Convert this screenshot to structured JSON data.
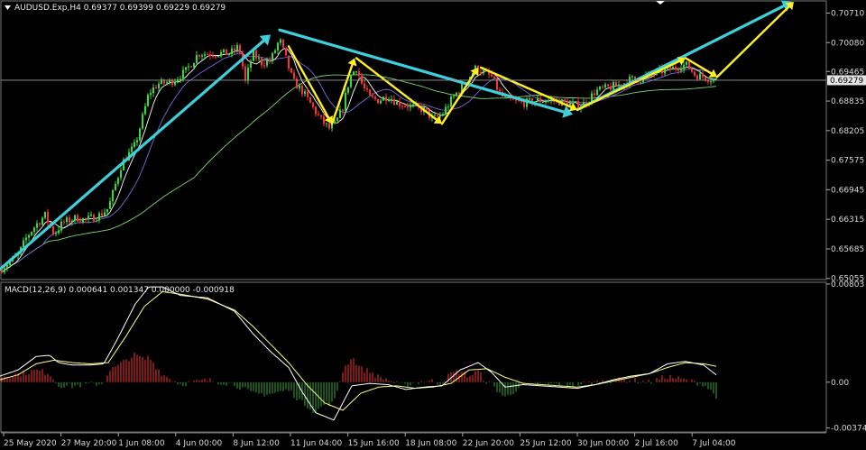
{
  "window": {
    "symbol_header": "AUDUSD.Exp,H4  0.69377 0.69399 0.69229 0.69279",
    "macd_header": "MACD(12,26,9) 0.000641 0.001347 0.000000 -0.000918"
  },
  "colors": {
    "background": "#000000",
    "bull_candle": "#33dd33",
    "bear_candle": "#ff3030",
    "ma_fast": "#ffffff",
    "ma_slow": "#7b68d8",
    "ma_long": "#7fd46f",
    "cyan_arrow": "#3ecfdc",
    "yellow_arrow": "#ffee22",
    "hist_pos": "#d12a2a",
    "hist_neg": "#2e8a2e",
    "macd_line": "#ffffff",
    "signal_line": "#ffff80"
  },
  "chart_data": [
    {
      "type": "candlestick",
      "symbol": "AUDUSD.Exp",
      "timeframe": "H4",
      "last_price": "0.69279",
      "ylim": [
        0.6505,
        0.7095
      ],
      "y_ticks": [
        "0.70710",
        "0.70080",
        "0.69465",
        "0.68835",
        "0.68205",
        "0.67575",
        "0.66945",
        "0.66315",
        "0.65685",
        "0.65055"
      ],
      "y_tick_values": [
        0.7071,
        0.7008,
        0.69465,
        0.68835,
        0.68205,
        0.67575,
        0.66945,
        0.66315,
        0.65685,
        0.65055
      ],
      "x_ticks": [
        "25 May 2020",
        "27 May 20:00",
        "1 Jun 08:00",
        "4 Jun 00:00",
        "8 Jun 12:00",
        "11 Jun 04:00",
        "15 Jun 16:00",
        "18 Jun 08:00",
        "22 Jun 20:00",
        "25 Jun 12:00",
        "30 Jun 00:00",
        "2 Jul 16:00",
        "7 Jul 04:00"
      ],
      "price_path": [
        [
          0,
          0.6525
        ],
        [
          10,
          0.654
        ],
        [
          20,
          0.6555
        ],
        [
          30,
          0.6595
        ],
        [
          40,
          0.662
        ],
        [
          50,
          0.664
        ],
        [
          60,
          0.66
        ],
        [
          70,
          0.6625
        ],
        [
          85,
          0.6635
        ],
        [
          95,
          0.663
        ],
        [
          110,
          0.664
        ],
        [
          120,
          0.6655
        ],
        [
          135,
          0.675
        ],
        [
          150,
          0.679
        ],
        [
          165,
          0.69
        ],
        [
          175,
          0.692
        ],
        [
          190,
          0.6925
        ],
        [
          205,
          0.6945
        ],
        [
          220,
          0.6985
        ],
        [
          240,
          0.6985
        ],
        [
          255,
          0.6985
        ],
        [
          265,
          0.7
        ],
        [
          272,
          0.6925
        ],
        [
          280,
          0.6985
        ],
        [
          290,
          0.6965
        ],
        [
          300,
          0.697
        ],
        [
          310,
          0.7015
        ],
        [
          315,
          0.6985
        ],
        [
          325,
          0.6925
        ],
        [
          335,
          0.6905
        ],
        [
          345,
          0.6875
        ],
        [
          355,
          0.6845
        ],
        [
          365,
          0.6825
        ],
        [
          372,
          0.6835
        ],
        [
          380,
          0.687
        ],
        [
          388,
          0.6935
        ],
        [
          395,
          0.6955
        ],
        [
          402,
          0.6915
        ],
        [
          410,
          0.689
        ],
        [
          420,
          0.6885
        ],
        [
          430,
          0.6895
        ],
        [
          440,
          0.688
        ],
        [
          450,
          0.6875
        ],
        [
          460,
          0.687
        ],
        [
          470,
          0.6865
        ],
        [
          480,
          0.6845
        ],
        [
          490,
          0.6855
        ],
        [
          500,
          0.6885
        ],
        [
          510,
          0.691
        ],
        [
          520,
          0.6935
        ],
        [
          528,
          0.6955
        ],
        [
          535,
          0.6945
        ],
        [
          545,
          0.6935
        ],
        [
          555,
          0.6895
        ],
        [
          565,
          0.6885
        ],
        [
          575,
          0.688
        ],
        [
          585,
          0.688
        ],
        [
          595,
          0.6885
        ],
        [
          605,
          0.6885
        ],
        [
          615,
          0.6885
        ],
        [
          625,
          0.688
        ],
        [
          635,
          0.6875
        ],
        [
          645,
          0.6875
        ],
        [
          652,
          0.6885
        ],
        [
          660,
          0.6905
        ],
        [
          670,
          0.691
        ],
        [
          680,
          0.6915
        ],
        [
          690,
          0.692
        ],
        [
          700,
          0.693
        ],
        [
          710,
          0.693
        ],
        [
          720,
          0.694
        ],
        [
          730,
          0.6945
        ],
        [
          740,
          0.695
        ],
        [
          750,
          0.6955
        ],
        [
          755,
          0.696
        ],
        [
          762,
          0.696
        ],
        [
          770,
          0.694
        ],
        [
          780,
          0.6935
        ],
        [
          790,
          0.693
        ],
        [
          794,
          0.6928
        ]
      ],
      "indicator_lines": [
        "fast MA",
        "slow MA",
        "long MA"
      ],
      "annotations": {
        "cyan_arrows": [
          [
            [
              0,
              0.6525
            ],
            [
              300,
              0.7025
            ]
          ],
          [
            [
              310,
              0.7035
            ],
            [
              635,
              0.6855
            ]
          ],
          [
            [
              640,
              0.6865
            ],
            [
              878,
              0.7095
            ]
          ]
        ],
        "yellow_arrows": [
          [
            [
              320,
              0.7
            ],
            [
              368,
              0.6835
            ]
          ],
          [
            [
              368,
              0.6835
            ],
            [
              393,
              0.6975
            ]
          ],
          [
            [
              395,
              0.6975
            ],
            [
              490,
              0.6835
            ]
          ],
          [
            [
              490,
              0.6835
            ],
            [
              530,
              0.6955
            ]
          ],
          [
            [
              533,
              0.6955
            ],
            [
              640,
              0.6865
            ]
          ],
          [
            [
              640,
              0.6865
            ],
            [
              760,
              0.6975
            ]
          ],
          [
            [
              760,
              0.6975
            ],
            [
              795,
              0.6935
            ]
          ],
          [
            [
              795,
              0.6935
            ],
            [
              880,
              0.7095
            ]
          ]
        ]
      }
    },
    {
      "type": "line+histogram",
      "indicator": "MACD(12,26,9)",
      "ylim": [
        -0.004,
        0.0081
      ],
      "y_ticks": [
        "0.00803",
        "0.00",
        "-0.003749"
      ],
      "y_tick_values": [
        0.00803,
        0,
        -0.003749
      ],
      "macd_path": [
        [
          0,
          0.0005
        ],
        [
          20,
          0.001
        ],
        [
          40,
          0.0021
        ],
        [
          55,
          0.0022
        ],
        [
          65,
          0.0016
        ],
        [
          80,
          0.0014
        ],
        [
          100,
          0.0014
        ],
        [
          115,
          0.0015
        ],
        [
          130,
          0.0035
        ],
        [
          150,
          0.0064
        ],
        [
          165,
          0.0078
        ],
        [
          180,
          0.0078
        ],
        [
          200,
          0.0071
        ],
        [
          230,
          0.0069
        ],
        [
          260,
          0.0058
        ],
        [
          280,
          0.004
        ],
        [
          300,
          0.0025
        ],
        [
          320,
          0.0012
        ],
        [
          335,
          -0.0008
        ],
        [
          350,
          -0.0025
        ],
        [
          370,
          -0.0031
        ],
        [
          390,
          -0.0003
        ],
        [
          410,
          -0.0001
        ],
        [
          430,
          -0.0002
        ],
        [
          450,
          -0.0006
        ],
        [
          470,
          -0.0004
        ],
        [
          490,
          -0.0003
        ],
        [
          510,
          0.001
        ],
        [
          530,
          0.0016
        ],
        [
          545,
          0.0008
        ],
        [
          560,
          -0.0004
        ],
        [
          580,
          -0.0002
        ],
        [
          600,
          -0.0003
        ],
        [
          620,
          -0.0004
        ],
        [
          640,
          -0.0005
        ],
        [
          660,
          -0.0002
        ],
        [
          680,
          0.0002
        ],
        [
          700,
          0.0005
        ],
        [
          720,
          0.0007
        ],
        [
          740,
          0.0015
        ],
        [
          760,
          0.0017
        ],
        [
          780,
          0.0014
        ],
        [
          794,
          0.0006
        ]
      ],
      "signal_path": [
        [
          0,
          0.0002
        ],
        [
          20,
          0.0006
        ],
        [
          40,
          0.0015
        ],
        [
          60,
          0.0018
        ],
        [
          80,
          0.0016
        ],
        [
          100,
          0.0015
        ],
        [
          120,
          0.0016
        ],
        [
          140,
          0.0038
        ],
        [
          160,
          0.0062
        ],
        [
          180,
          0.0074
        ],
        [
          200,
          0.0072
        ],
        [
          230,
          0.0068
        ],
        [
          260,
          0.0059
        ],
        [
          280,
          0.0046
        ],
        [
          300,
          0.0031
        ],
        [
          320,
          0.0016
        ],
        [
          340,
          -0.0002
        ],
        [
          360,
          -0.0017
        ],
        [
          380,
          -0.0023
        ],
        [
          400,
          -0.0009
        ],
        [
          420,
          -0.0004
        ],
        [
          440,
          -0.0003
        ],
        [
          460,
          -0.0005
        ],
        [
          480,
          -0.0004
        ],
        [
          500,
          -0.0001
        ],
        [
          520,
          0.001
        ],
        [
          540,
          0.0011
        ],
        [
          560,
          0.0004
        ],
        [
          580,
          -0.0001
        ],
        [
          600,
          -0.0002
        ],
        [
          620,
          -0.0003
        ],
        [
          640,
          -0.0004
        ],
        [
          660,
          -0.0002
        ],
        [
          680,
          0.0001
        ],
        [
          700,
          0.0004
        ],
        [
          720,
          0.0007
        ],
        [
          740,
          0.0012
        ],
        [
          760,
          0.0016
        ],
        [
          780,
          0.0015
        ],
        [
          794,
          0.0013
        ]
      ]
    }
  ]
}
